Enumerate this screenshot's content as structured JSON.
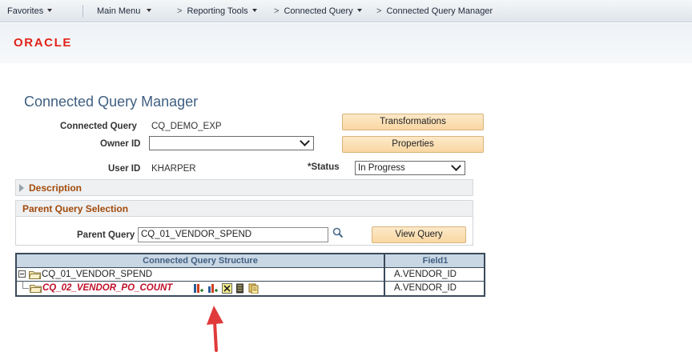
{
  "nav": {
    "favorites": "Favorites",
    "main_menu": "Main Menu",
    "reporting_tools": "Reporting Tools",
    "connected_query": "Connected Query",
    "connected_query_manager": "Connected Query Manager",
    "chevron": ">"
  },
  "brand": {
    "logo_text": "ORACLE",
    "logo_color": "#e2231a"
  },
  "page": {
    "title": "Connected Query Manager"
  },
  "form": {
    "connected_query_label": "Connected Query",
    "connected_query_value": "CQ_DEMO_EXP",
    "owner_id_label": "Owner ID",
    "owner_id_value": "",
    "user_id_label": "User ID",
    "user_id_value": "KHARPER",
    "status_label": "*Status",
    "status_value": "In Progress",
    "transformations_button": "Transformations",
    "properties_button": "Properties"
  },
  "description": {
    "label": "Description"
  },
  "parent_query": {
    "section_title": "Parent Query Selection",
    "label": "Parent Query",
    "value": "CQ_01_VENDOR_SPEND",
    "view_query_button": "View Query"
  },
  "grid": {
    "col1_header": "Connected Query Structure",
    "col2_header": "Field1",
    "rows": [
      {
        "name": "CQ_01_VENDOR_SPEND",
        "field": "A.VENDOR_ID"
      },
      {
        "name": "CQ_02_VENDOR_PO_COUNT",
        "field": "A.VENDOR_ID"
      }
    ]
  },
  "colors": {
    "accent_arrow": "#e03a3a",
    "section_title": "#a24a0a",
    "title": "#3f5f82"
  },
  "icons": [
    "search-icon",
    "add-child-query-icon",
    "add-sibling-query-icon",
    "delete-icon",
    "related-fields-icon",
    "properties-icon",
    "folder-icon",
    "collapse-icon"
  ]
}
